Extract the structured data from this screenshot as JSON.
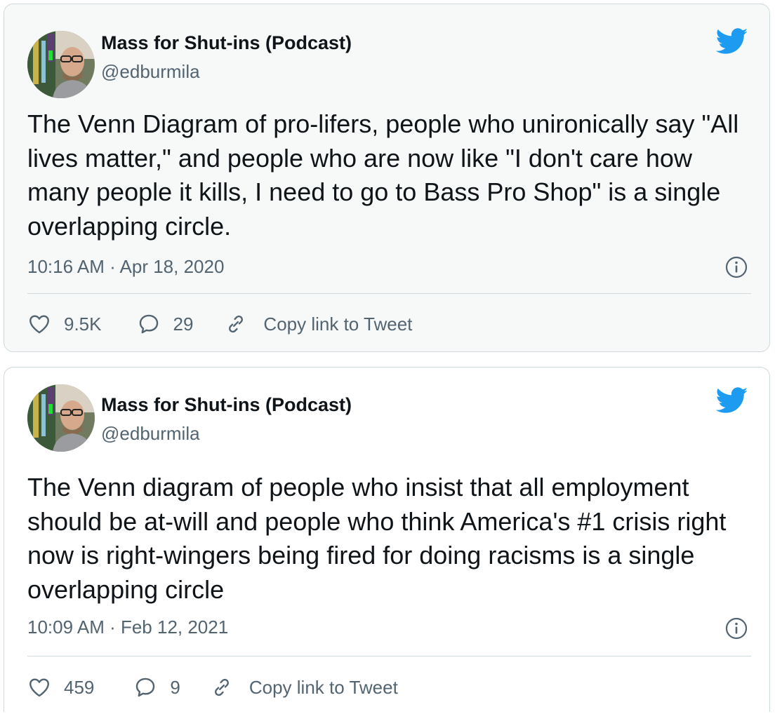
{
  "colors": {
    "twitter_blue": "#1d9bf0",
    "secondary_text": "#536471",
    "border": "#cfd9de"
  },
  "tweets": [
    {
      "author_name": "Mass for Shut-ins (Podcast)",
      "handle": "@edburmila",
      "text": "The Venn Diagram of pro-lifers, people who unironically say \"All lives matter,\" and people who are now like \"I don't care how many people it kills, I need to go to Bass Pro Shop\" is a single overlapping circle.",
      "timestamp": "10:16 AM · Apr 18, 2020",
      "likes": "9.5K",
      "replies": "29",
      "copy_link_label": "Copy link to Tweet",
      "icons": [
        "avatar",
        "twitter-bird-icon",
        "info-icon",
        "heart-icon",
        "reply-icon",
        "link-icon"
      ]
    },
    {
      "author_name": "Mass for Shut-ins (Podcast)",
      "handle": "@edburmila",
      "text": "The Venn diagram of people who insist that all employment should be at-will and people who think America's #1 crisis right now is right-wingers being fired for doing racisms is a single overlapping circle",
      "timestamp": "10:09 AM · Feb 12, 2021",
      "likes": "459",
      "replies": "9",
      "copy_link_label": "Copy link to Tweet",
      "icons": [
        "avatar",
        "twitter-bird-icon",
        "info-icon",
        "heart-icon",
        "reply-icon",
        "link-icon"
      ]
    }
  ]
}
